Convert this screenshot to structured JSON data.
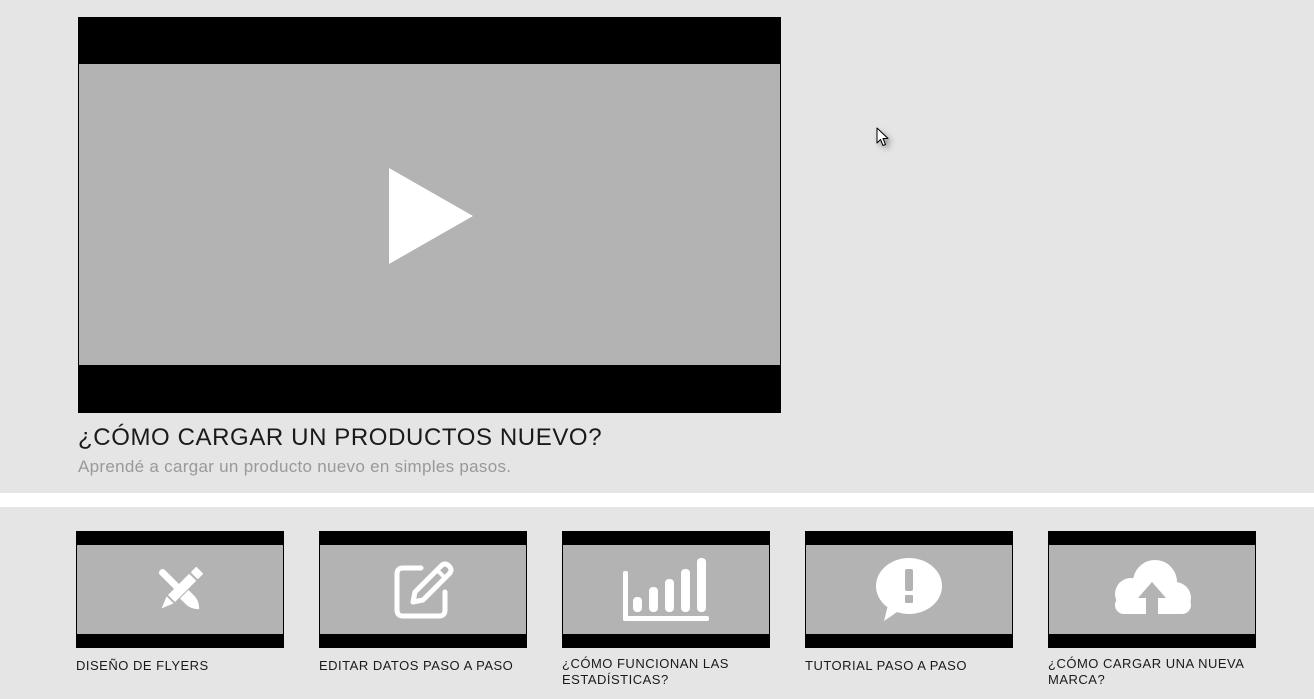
{
  "featured_video": {
    "title": "¿CÓMO CARGAR UN PRODUCTOS NUEVO?",
    "subtitle": "Aprendé a cargar un producto nuevo en simples pasos.",
    "icon": "play-icon"
  },
  "tutorials": [
    {
      "label": "DISEÑO DE FLYERS",
      "icon": "pencil-brush-icon"
    },
    {
      "label": "EDITAR DATOS PASO A PASO",
      "icon": "edit-icon"
    },
    {
      "label": "¿CÓMO FUNCIONAN LAS ESTADÍSTICAS?",
      "icon": "bar-chart-icon"
    },
    {
      "label": "TUTORIAL PASO A PASO",
      "icon": "alert-bubble-icon"
    },
    {
      "label": "¿CÓMO CARGAR UNA NUEVA MARCA?",
      "icon": "cloud-upload-icon"
    }
  ],
  "colors": {
    "background": "#e5e5e5",
    "divider": "#ffffff",
    "letterbox": "#000000",
    "video_screen": "#b3b3b3",
    "title_text": "#1a1a1a",
    "subtitle_text": "#999999"
  }
}
